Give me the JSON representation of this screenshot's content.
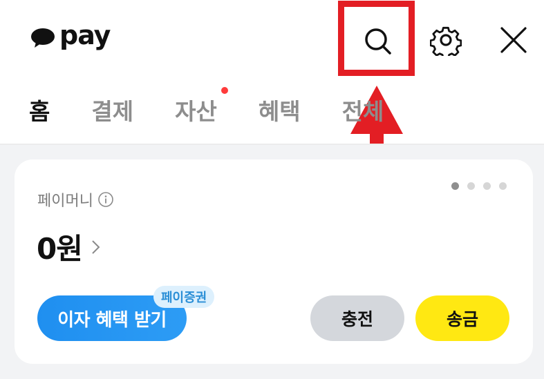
{
  "header": {
    "logo_text": "pay",
    "icons": [
      "search-icon",
      "gear-icon",
      "close-icon"
    ]
  },
  "tabs": [
    {
      "label": "홈",
      "active": true
    },
    {
      "label": "결제",
      "active": false
    },
    {
      "label": "자산",
      "active": false,
      "has_badge_dot": true
    },
    {
      "label": "혜택",
      "active": false
    },
    {
      "label": "전체",
      "active": false
    }
  ],
  "card": {
    "label": "페이머니",
    "balance": "0원",
    "carousel_dots": {
      "total": 4,
      "active_index": 0
    },
    "interest_button": "이자 혜택 받기",
    "interest_badge": "페이증권",
    "charge_button": "충전",
    "send_button": "송금"
  },
  "colors": {
    "highlight": "#e31e24",
    "interest_blue": "#1f8ff0",
    "send_yellow": "#ffe812",
    "charge_gray": "#d4d7dc",
    "badge_dot": "#ff3b3b"
  }
}
